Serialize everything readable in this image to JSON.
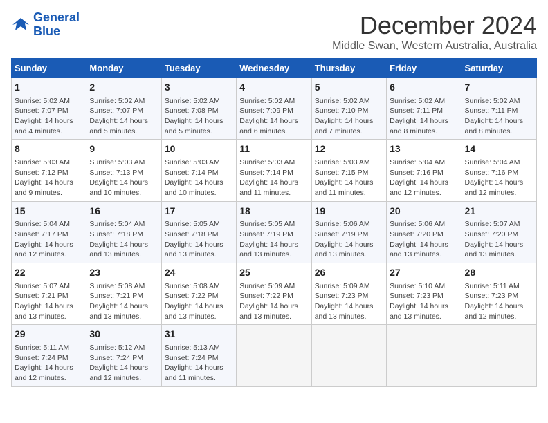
{
  "logo": {
    "line1": "General",
    "line2": "Blue"
  },
  "title": "December 2024",
  "location": "Middle Swan, Western Australia, Australia",
  "weekdays": [
    "Sunday",
    "Monday",
    "Tuesday",
    "Wednesday",
    "Thursday",
    "Friday",
    "Saturday"
  ],
  "weeks": [
    [
      {
        "day": "1",
        "sunrise": "5:02 AM",
        "sunset": "7:07 PM",
        "daylight": "14 hours and 4 minutes."
      },
      {
        "day": "2",
        "sunrise": "5:02 AM",
        "sunset": "7:07 PM",
        "daylight": "14 hours and 5 minutes."
      },
      {
        "day": "3",
        "sunrise": "5:02 AM",
        "sunset": "7:08 PM",
        "daylight": "14 hours and 5 minutes."
      },
      {
        "day": "4",
        "sunrise": "5:02 AM",
        "sunset": "7:09 PM",
        "daylight": "14 hours and 6 minutes."
      },
      {
        "day": "5",
        "sunrise": "5:02 AM",
        "sunset": "7:10 PM",
        "daylight": "14 hours and 7 minutes."
      },
      {
        "day": "6",
        "sunrise": "5:02 AM",
        "sunset": "7:11 PM",
        "daylight": "14 hours and 8 minutes."
      },
      {
        "day": "7",
        "sunrise": "5:02 AM",
        "sunset": "7:11 PM",
        "daylight": "14 hours and 8 minutes."
      }
    ],
    [
      {
        "day": "8",
        "sunrise": "5:03 AM",
        "sunset": "7:12 PM",
        "daylight": "14 hours and 9 minutes."
      },
      {
        "day": "9",
        "sunrise": "5:03 AM",
        "sunset": "7:13 PM",
        "daylight": "14 hours and 10 minutes."
      },
      {
        "day": "10",
        "sunrise": "5:03 AM",
        "sunset": "7:14 PM",
        "daylight": "14 hours and 10 minutes."
      },
      {
        "day": "11",
        "sunrise": "5:03 AM",
        "sunset": "7:14 PM",
        "daylight": "14 hours and 11 minutes."
      },
      {
        "day": "12",
        "sunrise": "5:03 AM",
        "sunset": "7:15 PM",
        "daylight": "14 hours and 11 minutes."
      },
      {
        "day": "13",
        "sunrise": "5:04 AM",
        "sunset": "7:16 PM",
        "daylight": "14 hours and 12 minutes."
      },
      {
        "day": "14",
        "sunrise": "5:04 AM",
        "sunset": "7:16 PM",
        "daylight": "14 hours and 12 minutes."
      }
    ],
    [
      {
        "day": "15",
        "sunrise": "5:04 AM",
        "sunset": "7:17 PM",
        "daylight": "14 hours and 12 minutes."
      },
      {
        "day": "16",
        "sunrise": "5:04 AM",
        "sunset": "7:18 PM",
        "daylight": "14 hours and 13 minutes."
      },
      {
        "day": "17",
        "sunrise": "5:05 AM",
        "sunset": "7:18 PM",
        "daylight": "14 hours and 13 minutes."
      },
      {
        "day": "18",
        "sunrise": "5:05 AM",
        "sunset": "7:19 PM",
        "daylight": "14 hours and 13 minutes."
      },
      {
        "day": "19",
        "sunrise": "5:06 AM",
        "sunset": "7:19 PM",
        "daylight": "14 hours and 13 minutes."
      },
      {
        "day": "20",
        "sunrise": "5:06 AM",
        "sunset": "7:20 PM",
        "daylight": "14 hours and 13 minutes."
      },
      {
        "day": "21",
        "sunrise": "5:07 AM",
        "sunset": "7:20 PM",
        "daylight": "14 hours and 13 minutes."
      }
    ],
    [
      {
        "day": "22",
        "sunrise": "5:07 AM",
        "sunset": "7:21 PM",
        "daylight": "14 hours and 13 minutes."
      },
      {
        "day": "23",
        "sunrise": "5:08 AM",
        "sunset": "7:21 PM",
        "daylight": "14 hours and 13 minutes."
      },
      {
        "day": "24",
        "sunrise": "5:08 AM",
        "sunset": "7:22 PM",
        "daylight": "14 hours and 13 minutes."
      },
      {
        "day": "25",
        "sunrise": "5:09 AM",
        "sunset": "7:22 PM",
        "daylight": "14 hours and 13 minutes."
      },
      {
        "day": "26",
        "sunrise": "5:09 AM",
        "sunset": "7:23 PM",
        "daylight": "14 hours and 13 minutes."
      },
      {
        "day": "27",
        "sunrise": "5:10 AM",
        "sunset": "7:23 PM",
        "daylight": "14 hours and 13 minutes."
      },
      {
        "day": "28",
        "sunrise": "5:11 AM",
        "sunset": "7:23 PM",
        "daylight": "14 hours and 12 minutes."
      }
    ],
    [
      {
        "day": "29",
        "sunrise": "5:11 AM",
        "sunset": "7:24 PM",
        "daylight": "14 hours and 12 minutes."
      },
      {
        "day": "30",
        "sunrise": "5:12 AM",
        "sunset": "7:24 PM",
        "daylight": "14 hours and 12 minutes."
      },
      {
        "day": "31",
        "sunrise": "5:13 AM",
        "sunset": "7:24 PM",
        "daylight": "14 hours and 11 minutes."
      },
      null,
      null,
      null,
      null
    ]
  ],
  "labels": {
    "sunrise": "Sunrise:",
    "sunset": "Sunset:",
    "daylight": "Daylight:"
  }
}
